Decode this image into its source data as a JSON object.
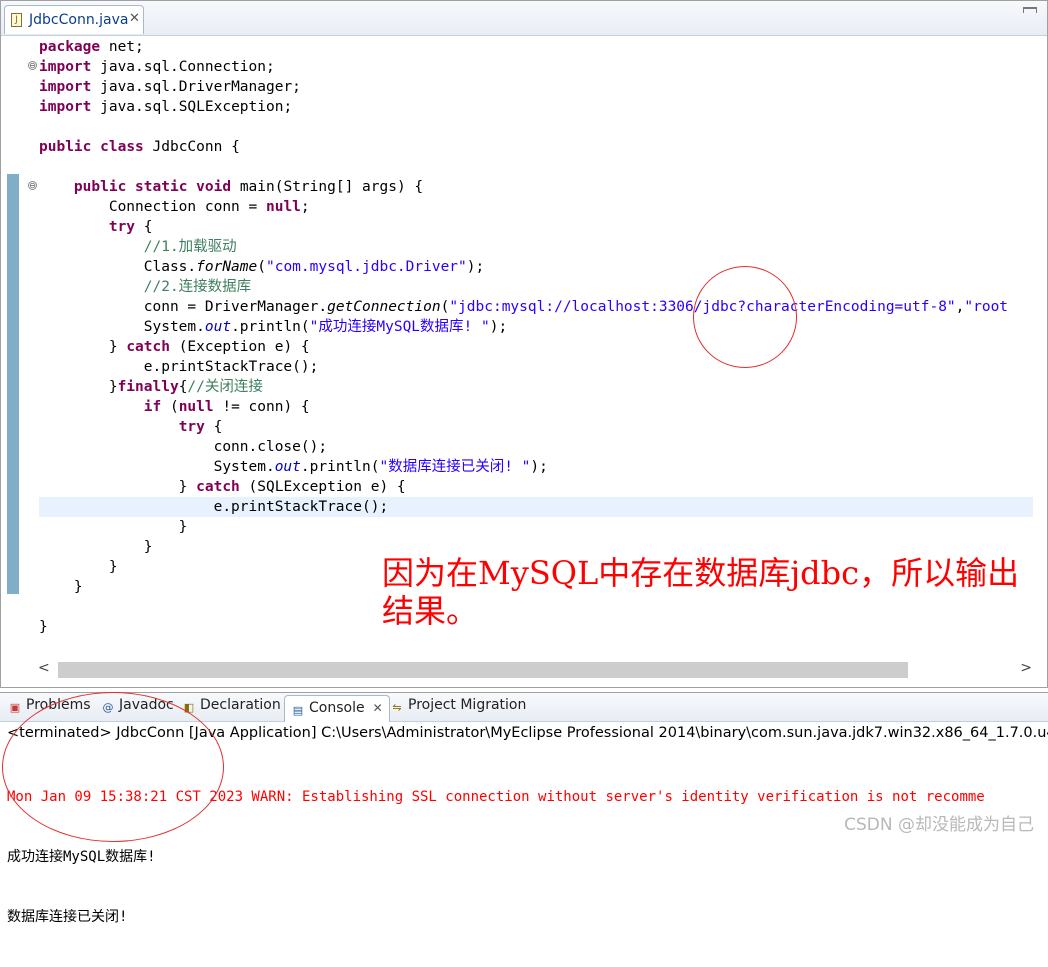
{
  "editor": {
    "tab_label": "JdbcConn.java",
    "tab_close": "✕",
    "tab_icon": "J"
  },
  "code_lines": [
    "package net;",
    "import java.sql.Connection;",
    "import java.sql.DriverManager;",
    "import java.sql.SQLException;",
    "",
    "public class JdbcConn {",
    "",
    "    public static void main(String[] args) {",
    "        Connection conn = null;",
    "        try {",
    "            //1.加载驱动",
    "            Class.forName(\"com.mysql.jdbc.Driver\");",
    "            //2.连接数据库",
    "            conn = DriverManager.getConnection(\"jdbc:mysql://localhost:3306/jdbc?characterEncoding=utf-8\",\"root",
    "            System.out.println(\"成功连接MySQL数据库! \");",
    "        } catch (Exception e) {",
    "            e.printStackTrace();",
    "        }finally{//关闭连接",
    "            if (null != conn) {",
    "                try {",
    "                    conn.close();",
    "                    System.out.println(\"数据库连接已关闭! \");",
    "                } catch (SQLException e) {",
    "                    e.printStackTrace();",
    "                }",
    "            }",
    "        }",
    "    }",
    "",
    "}"
  ],
  "annotation": "因为在MySQL中存在数据库jdbc，所以输出结果。",
  "scroll": {
    "left_arrow": "<",
    "right_arrow": ">"
  },
  "console": {
    "tabs": [
      {
        "label": "Problems",
        "icon": "problems-icon"
      },
      {
        "label": "Javadoc",
        "icon": "javadoc-icon"
      },
      {
        "label": "Declaration",
        "icon": "declaration-icon"
      },
      {
        "label": "Console",
        "icon": "console-icon",
        "close": "✕"
      },
      {
        "label": "Project Migration",
        "icon": "migration-icon"
      }
    ],
    "terminated": "<terminated> JdbcConn [Java Application] C:\\Users\\Administrator\\MyEclipse Professional 2014\\binary\\com.sun.java.jdk7.win32.x86_64_1.7.0.u4",
    "output": [
      "Mon Jan 09 15:38:21 CST 2023 WARN: Establishing SSL connection without server's identity verification is not recomme",
      "成功连接MySQL数据库!",
      "数据库连接已关闭!"
    ]
  },
  "watermark": "CSDN @却没能成为自己",
  "colors": {
    "keyword": "#7f0055",
    "string": "#2a00ff",
    "comment": "#3f7f5f",
    "annotation": "#ff0000",
    "error": "#ff0000"
  }
}
